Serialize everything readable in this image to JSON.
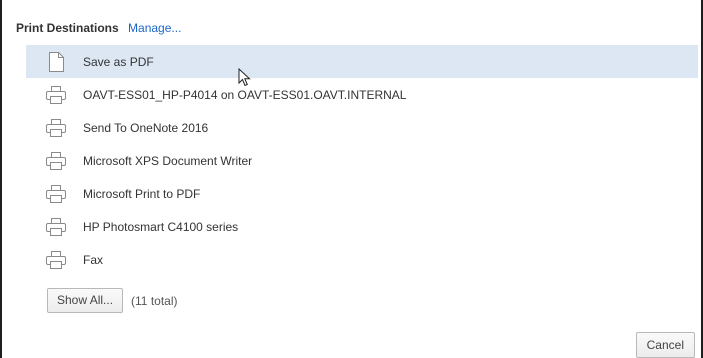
{
  "header": {
    "title": "Print Destinations",
    "manage_label": "Manage..."
  },
  "destinations": [
    {
      "label": "Save as PDF",
      "icon": "pdf-page-icon",
      "selected": true
    },
    {
      "label": "OAVT-ESS01_HP-P4014 on OAVT-ESS01.OAVT.INTERNAL",
      "icon": "printer-icon",
      "selected": false
    },
    {
      "label": "Send To OneNote 2016",
      "icon": "printer-icon",
      "selected": false
    },
    {
      "label": "Microsoft XPS Document Writer",
      "icon": "printer-icon",
      "selected": false
    },
    {
      "label": "Microsoft Print to PDF",
      "icon": "printer-icon",
      "selected": false
    },
    {
      "label": "HP Photosmart C4100 series",
      "icon": "printer-icon",
      "selected": false
    },
    {
      "label": "Fax",
      "icon": "printer-icon",
      "selected": false
    }
  ],
  "show_all": {
    "label": "Show All...",
    "total_text": "(11 total)"
  },
  "footer": {
    "cancel_label": "Cancel"
  },
  "colors": {
    "selected_row": "#dde7f3",
    "link": "#1a66cc",
    "text": "#333333"
  }
}
